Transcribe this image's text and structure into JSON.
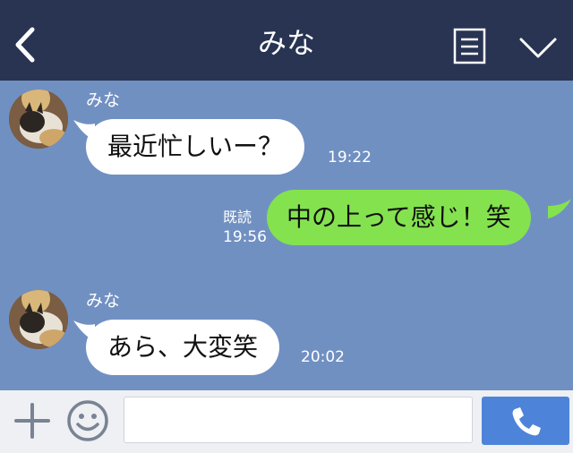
{
  "header": {
    "title": "みな",
    "back_icon": "chevron-left-icon",
    "menu_icon": "note-icon",
    "collapse_icon": "chevron-down-icon",
    "background": "#283452"
  },
  "chat": {
    "background": "#7190c2",
    "messages": [
      {
        "direction": "incoming",
        "sender": "みな",
        "text": "最近忙しいー？",
        "time": "19:22"
      },
      {
        "direction": "outgoing",
        "status": "既読",
        "text": "中の上って感じ！笑",
        "time": "19:56"
      },
      {
        "direction": "incoming",
        "sender": "みな",
        "text": "あら、大変笑",
        "time": "20:02"
      }
    ]
  },
  "footer": {
    "plus_icon": "plus-icon",
    "emoji_icon": "smiley-icon",
    "input_value": "",
    "call_icon": "phone-icon",
    "call_color": "#4d84d9"
  },
  "colors": {
    "incoming_bubble": "#ffffff",
    "outgoing_bubble": "#84e24f"
  }
}
